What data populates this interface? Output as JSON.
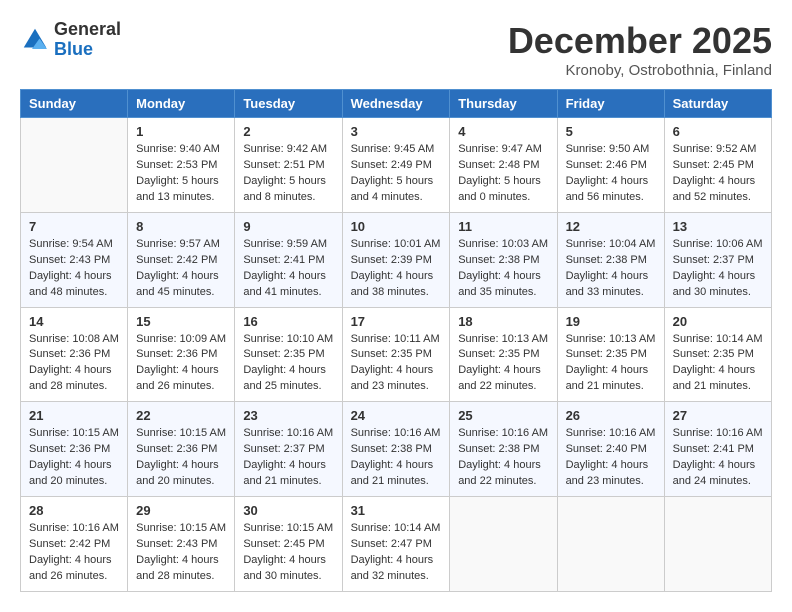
{
  "logo": {
    "general": "General",
    "blue": "Blue"
  },
  "title": "December 2025",
  "location": "Kronoby, Ostrobothnia, Finland",
  "weekdays": [
    "Sunday",
    "Monday",
    "Tuesday",
    "Wednesday",
    "Thursday",
    "Friday",
    "Saturday"
  ],
  "weeks": [
    [
      {
        "day": "",
        "info": ""
      },
      {
        "day": "1",
        "info": "Sunrise: 9:40 AM\nSunset: 2:53 PM\nDaylight: 5 hours\nand 13 minutes."
      },
      {
        "day": "2",
        "info": "Sunrise: 9:42 AM\nSunset: 2:51 PM\nDaylight: 5 hours\nand 8 minutes."
      },
      {
        "day": "3",
        "info": "Sunrise: 9:45 AM\nSunset: 2:49 PM\nDaylight: 5 hours\nand 4 minutes."
      },
      {
        "day": "4",
        "info": "Sunrise: 9:47 AM\nSunset: 2:48 PM\nDaylight: 5 hours\nand 0 minutes."
      },
      {
        "day": "5",
        "info": "Sunrise: 9:50 AM\nSunset: 2:46 PM\nDaylight: 4 hours\nand 56 minutes."
      },
      {
        "day": "6",
        "info": "Sunrise: 9:52 AM\nSunset: 2:45 PM\nDaylight: 4 hours\nand 52 minutes."
      }
    ],
    [
      {
        "day": "7",
        "info": "Sunrise: 9:54 AM\nSunset: 2:43 PM\nDaylight: 4 hours\nand 48 minutes."
      },
      {
        "day": "8",
        "info": "Sunrise: 9:57 AM\nSunset: 2:42 PM\nDaylight: 4 hours\nand 45 minutes."
      },
      {
        "day": "9",
        "info": "Sunrise: 9:59 AM\nSunset: 2:41 PM\nDaylight: 4 hours\nand 41 minutes."
      },
      {
        "day": "10",
        "info": "Sunrise: 10:01 AM\nSunset: 2:39 PM\nDaylight: 4 hours\nand 38 minutes."
      },
      {
        "day": "11",
        "info": "Sunrise: 10:03 AM\nSunset: 2:38 PM\nDaylight: 4 hours\nand 35 minutes."
      },
      {
        "day": "12",
        "info": "Sunrise: 10:04 AM\nSunset: 2:38 PM\nDaylight: 4 hours\nand 33 minutes."
      },
      {
        "day": "13",
        "info": "Sunrise: 10:06 AM\nSunset: 2:37 PM\nDaylight: 4 hours\nand 30 minutes."
      }
    ],
    [
      {
        "day": "14",
        "info": "Sunrise: 10:08 AM\nSunset: 2:36 PM\nDaylight: 4 hours\nand 28 minutes."
      },
      {
        "day": "15",
        "info": "Sunrise: 10:09 AM\nSunset: 2:36 PM\nDaylight: 4 hours\nand 26 minutes."
      },
      {
        "day": "16",
        "info": "Sunrise: 10:10 AM\nSunset: 2:35 PM\nDaylight: 4 hours\nand 25 minutes."
      },
      {
        "day": "17",
        "info": "Sunrise: 10:11 AM\nSunset: 2:35 PM\nDaylight: 4 hours\nand 23 minutes."
      },
      {
        "day": "18",
        "info": "Sunrise: 10:13 AM\nSunset: 2:35 PM\nDaylight: 4 hours\nand 22 minutes."
      },
      {
        "day": "19",
        "info": "Sunrise: 10:13 AM\nSunset: 2:35 PM\nDaylight: 4 hours\nand 21 minutes."
      },
      {
        "day": "20",
        "info": "Sunrise: 10:14 AM\nSunset: 2:35 PM\nDaylight: 4 hours\nand 21 minutes."
      }
    ],
    [
      {
        "day": "21",
        "info": "Sunrise: 10:15 AM\nSunset: 2:36 PM\nDaylight: 4 hours\nand 20 minutes."
      },
      {
        "day": "22",
        "info": "Sunrise: 10:15 AM\nSunset: 2:36 PM\nDaylight: 4 hours\nand 20 minutes."
      },
      {
        "day": "23",
        "info": "Sunrise: 10:16 AM\nSunset: 2:37 PM\nDaylight: 4 hours\nand 21 minutes."
      },
      {
        "day": "24",
        "info": "Sunrise: 10:16 AM\nSunset: 2:38 PM\nDaylight: 4 hours\nand 21 minutes."
      },
      {
        "day": "25",
        "info": "Sunrise: 10:16 AM\nSunset: 2:38 PM\nDaylight: 4 hours\nand 22 minutes."
      },
      {
        "day": "26",
        "info": "Sunrise: 10:16 AM\nSunset: 2:40 PM\nDaylight: 4 hours\nand 23 minutes."
      },
      {
        "day": "27",
        "info": "Sunrise: 10:16 AM\nSunset: 2:41 PM\nDaylight: 4 hours\nand 24 minutes."
      }
    ],
    [
      {
        "day": "28",
        "info": "Sunrise: 10:16 AM\nSunset: 2:42 PM\nDaylight: 4 hours\nand 26 minutes."
      },
      {
        "day": "29",
        "info": "Sunrise: 10:15 AM\nSunset: 2:43 PM\nDaylight: 4 hours\nand 28 minutes."
      },
      {
        "day": "30",
        "info": "Sunrise: 10:15 AM\nSunset: 2:45 PM\nDaylight: 4 hours\nand 30 minutes."
      },
      {
        "day": "31",
        "info": "Sunrise: 10:14 AM\nSunset: 2:47 PM\nDaylight: 4 hours\nand 32 minutes."
      },
      {
        "day": "",
        "info": ""
      },
      {
        "day": "",
        "info": ""
      },
      {
        "day": "",
        "info": ""
      }
    ]
  ]
}
